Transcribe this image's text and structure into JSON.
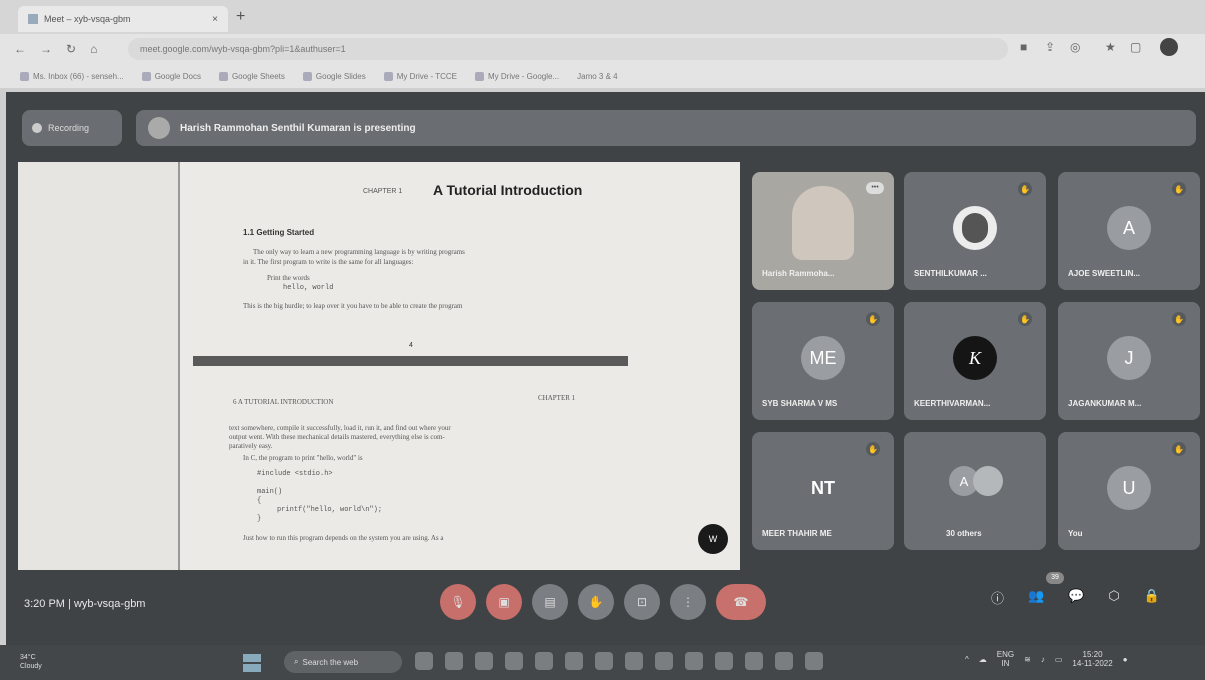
{
  "browser": {
    "tab_title": "Meet – xyb-vsqa-gbm",
    "tab_close": "×",
    "new_tab": "+",
    "url": "meet.google.com/wyb-vsqa-gbm?pli=1&authuser=1",
    "bookmarks": [
      "Ms. Inbox (66) - senseh...",
      "Google Docs",
      "Google Sheets",
      "Google Slides",
      "My Drive - TCCE",
      "My Drive - Google...",
      "Jamo 3 & 4"
    ]
  },
  "meet": {
    "recording_label": "Recording",
    "presenting_banner": "Harish Rammohan Senthil Kumaran is presenting",
    "shared_doc": {
      "chapter_label": "CHAPTER 1",
      "chapter_title": "A Tutorial Introduction",
      "section": "1.1   Getting Started",
      "p1_line1": "The only way to learn a new programming language is by writing programs",
      "p1_line2": "in it. The first program to write is the same for all languages:",
      "print_line": "Print the words",
      "hello_line": "hello, world",
      "p2": "This is the big hurdle; to leap over it you have to be able to create the program",
      "page_num": "4",
      "page2_header_left": "6   A TUTORIAL INTRODUCTION",
      "page2_header_right": "CHAPTER 1",
      "p3_line1": "text somewhere, compile it successfully, load it, run it, and find out where your",
      "p3_line2": "output went. With these mechanical details mastered, everything else is com-",
      "p3_line3": "paratively easy.",
      "p4": "In C, the program to print \"hello, world\" is",
      "code1": "#include <stdio.h>",
      "code2": "main()",
      "code3": "{",
      "code4": "printf(\"hello, world\\n\");",
      "code5": "}",
      "p5": "Just how to run this program depends on the system you are using.  As a",
      "badge": "W"
    },
    "participants": [
      {
        "name": "Harish Rammoha...",
        "type": "video"
      },
      {
        "name": "SENTHILKUMAR ...",
        "type": "photo",
        "initial": ""
      },
      {
        "name": "AJOE SWEETLIN...",
        "type": "initial",
        "initial": "A"
      },
      {
        "name": "SYB SHARMA V MS",
        "type": "initial",
        "initial": "ME"
      },
      {
        "name": "KEERTHIVARMAN...",
        "type": "initial",
        "initial": "K"
      },
      {
        "name": "JAGANKUMAR M...",
        "type": "initial",
        "initial": "J"
      },
      {
        "name": "MEER THAHIR ME",
        "type": "initial",
        "initial": "NT"
      },
      {
        "name": "30 others",
        "type": "group",
        "initial": "A"
      },
      {
        "name": "You",
        "type": "initial",
        "initial": "U"
      }
    ],
    "more_label": "•••",
    "time": "3:20 PM",
    "separator": "|",
    "meeting_code": "wyb-vsqa-gbm",
    "people_count": "39"
  },
  "taskbar": {
    "weather_temp": "34°C",
    "weather_desc": "Cloudy",
    "search_label": "Search the web",
    "lang_top": "ENG",
    "lang_bottom": "IN",
    "clock_time": "15:20",
    "clock_date": "14-11-2022"
  },
  "colors": {
    "meet_bg": "#3f4346",
    "tile_bg": "#6b6f73",
    "end_call": "#c8706b"
  }
}
